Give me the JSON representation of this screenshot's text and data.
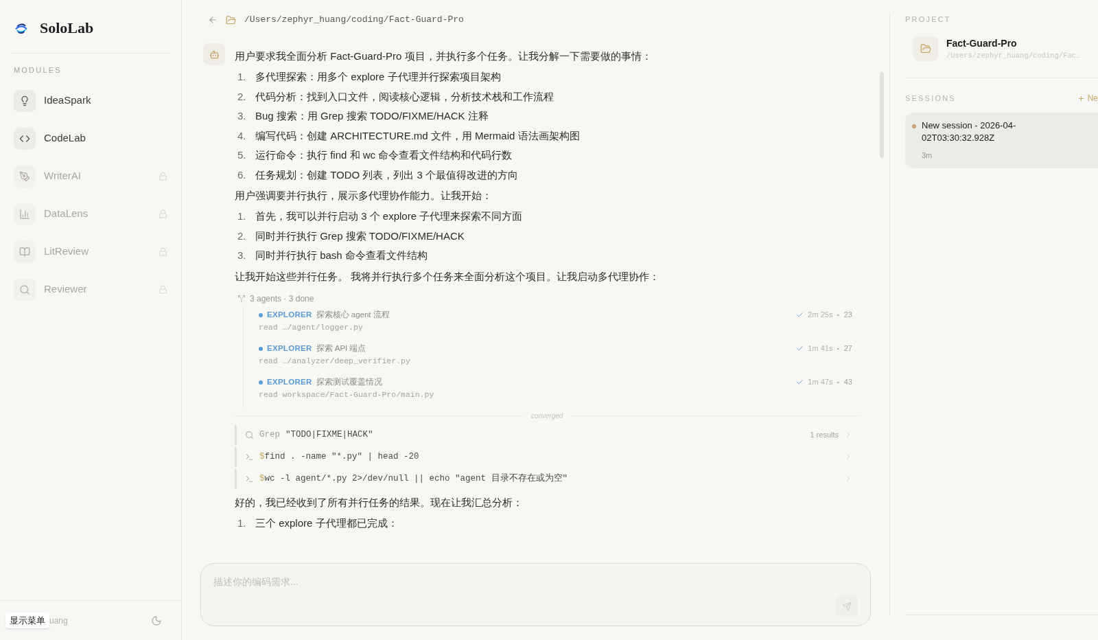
{
  "sidebar": {
    "app_name": "SoloLab",
    "section_label": "MODULES",
    "modules": [
      {
        "label": "IdeaSpark",
        "locked": false
      },
      {
        "label": "CodeLab",
        "locked": false
      },
      {
        "label": "WriterAI",
        "locked": true
      },
      {
        "label": "DataLens",
        "locked": true
      },
      {
        "label": "LitReview",
        "locked": true
      },
      {
        "label": "Reviewer",
        "locked": true
      }
    ],
    "user_name": "uang",
    "tooltip": "显示菜单"
  },
  "header": {
    "path": "/Users/zephyr_huang/coding/Fact-Guard-Pro"
  },
  "messages": [
    {
      "kind": "paragraph",
      "text": "用户要求我全面分析 Fact-Guard-Pro 项目，并执行多个任务。让我分解一下需要做的事情："
    },
    {
      "kind": "list",
      "items": [
        {
          "number": "1.",
          "text": "多代理探索：用多个 explore 子代理并行探索项目架构"
        },
        {
          "number": "2.",
          "text": "代码分析：找到入口文件，阅读核心逻辑，分析技术栈和工作流程"
        },
        {
          "number": "3.",
          "text": "Bug 搜索：用 Grep 搜索 TODO/FIXME/HACK 注释"
        },
        {
          "number": "4.",
          "text": "编写代码：创建 ARCHITECTURE.md 文件，用 Mermaid 语法画架构图"
        },
        {
          "number": "5.",
          "text": "运行命令：执行 find 和 wc 命令查看文件结构和代码行数"
        },
        {
          "number": "6.",
          "text": "任务规划：创建 TODO 列表，列出 3 个最值得改进的方向"
        }
      ]
    },
    {
      "kind": "paragraph",
      "text": "用户强调要并行执行，展示多代理协作能力。让我开始："
    },
    {
      "kind": "list",
      "items": [
        {
          "number": "1.",
          "text": "首先，我可以并行启动 3 个 explore 子代理来探索不同方面"
        },
        {
          "number": "2.",
          "text": "同时并行执行 Grep 搜索 TODO/FIXME/HACK"
        },
        {
          "number": "3.",
          "text": "同时并行执行 bash 命令查看文件结构"
        }
      ]
    },
    {
      "kind": "paragraph",
      "text": "让我开始这些并行任务。 我将并行执行多个任务来全面分析这个项目。让我启动多代理协作："
    },
    {
      "kind": "agents",
      "summary": "3 agents · 3 done",
      "divider_label": "converged",
      "agents": [
        {
          "role": "EXPLORER",
          "task": "探索核心 agent 流程",
          "detail": "read …/agent/logger.py",
          "done": true,
          "duration": "2m 25s",
          "separator": "·",
          "count": "23"
        },
        {
          "role": "EXPLORER",
          "task": "探索 API 端点",
          "detail": "read …/analyzer/deep_verifier.py",
          "done": true,
          "duration": "1m 41s",
          "separator": "·",
          "count": "27"
        },
        {
          "role": "EXPLORER",
          "task": "探索测试覆盖情况",
          "detail": "read workspace/Fact-Guard-Pro/main.py",
          "done": true,
          "duration": "1m 47s",
          "separator": "·",
          "count": "43"
        }
      ]
    },
    {
      "kind": "tools",
      "calls": [
        {
          "kind": "grep",
          "name": "Grep",
          "command": "\"TODO|FIXME|HACK\"",
          "result": "1 results"
        },
        {
          "kind": "shell",
          "name": "$",
          "command": "find . -name \"*.py\" | head -20"
        },
        {
          "kind": "shell",
          "name": "$",
          "command": "wc -l agent/*.py 2>/dev/null || echo \"agent 目录不存在或为空\""
        }
      ]
    },
    {
      "kind": "paragraph",
      "text": "好的，我已经收到了所有并行任务的结果。现在让我汇总分析："
    },
    {
      "kind": "list",
      "items": [
        {
          "number": "1.",
          "text": "三个 explore 子代理都已完成："
        }
      ]
    }
  ],
  "composer": {
    "placeholder": "描述你的编码需求..."
  },
  "right_panel": {
    "project_label": "PROJECT",
    "project_name": "Fact-Guard-Pro",
    "project_path": "/Users/zephyr_huang/coding/Fac…",
    "sessions_label": "SESSIONS",
    "new_label": "Ne",
    "sessions": [
      {
        "title": "New session - 2026-04-02T03:30:32.928Z",
        "age": "3m",
        "selected": true
      }
    ]
  }
}
